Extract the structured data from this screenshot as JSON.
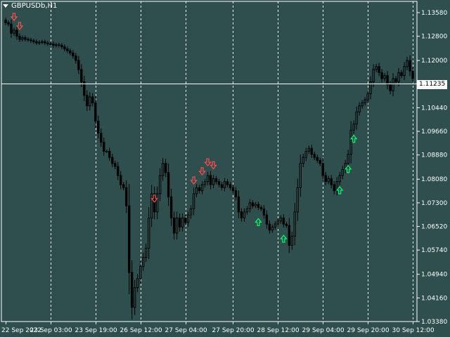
{
  "window": {
    "symbol_title": "GBPUSDb,H1"
  },
  "current_price": "1.11235",
  "colors": {
    "background": "#2f4f4f",
    "grid": "#ffffff",
    "bull_candle": "#000000",
    "bear_candle": "#000000",
    "wick": "#000000",
    "up_arrow": "#00ff66",
    "down_arrow": "#ff4d4d"
  },
  "chart_data": {
    "type": "candlestick",
    "symbol": "GBPUSDb",
    "timeframe": "H1",
    "y_axis_ticks": [
      "1.13580",
      "1.12800",
      "1.12000",
      "1.11235",
      "1.10440",
      "1.09660",
      "1.08880",
      "1.08080",
      "1.07300",
      "1.06520",
      "1.05740",
      "1.04940",
      "1.04160",
      "1.03380"
    ],
    "ylim": [
      1.0338,
      1.1395
    ],
    "x_axis_ticks": [
      "22 Sep 2022",
      "23 Sep 03:00",
      "23 Sep 19:00",
      "26 Sep 12:00",
      "27 Sep 04:00",
      "27 Sep 20:00",
      "28 Sep 12:00",
      "29 Sep 04:00",
      "29 Sep 20:00",
      "30 Sep 12:00"
    ],
    "close": [
      1.1325,
      1.132,
      1.129,
      1.13,
      1.128,
      1.127,
      1.1275,
      1.127,
      1.1268,
      1.1265,
      1.1262,
      1.1258,
      1.126,
      1.1262,
      1.1258,
      1.1255,
      1.1255,
      1.125,
      1.1252,
      1.125,
      1.1245,
      1.1238,
      1.1232,
      1.1225,
      1.1215,
      1.12,
      1.117,
      1.113,
      1.1085,
      1.105,
      1.108,
      1.106,
      1.1,
      1.096,
      1.093,
      1.09,
      1.09,
      1.088,
      1.086,
      1.085,
      1.082,
      1.079,
      1.078,
      1.072,
      1.05,
      1.0385,
      1.045,
      1.048,
      1.052,
      1.055,
      1.058,
      1.068,
      1.076,
      1.07,
      1.076,
      1.082,
      1.086,
      1.083,
      1.075,
      1.068,
      1.063,
      1.068,
      1.065,
      1.068,
      1.0665,
      1.069,
      1.071,
      1.076,
      1.078,
      1.077,
      1.079,
      1.08,
      1.082,
      1.079,
      1.081,
      1.08,
      1.079,
      1.078,
      1.08,
      1.079,
      1.078,
      1.077,
      1.075,
      1.07,
      1.068,
      1.07,
      1.071,
      1.073,
      1.072,
      1.0725,
      1.0715,
      1.071,
      1.069,
      1.066,
      1.064,
      1.065,
      1.066,
      1.067,
      1.068,
      1.066,
      1.0655,
      1.059,
      1.062,
      1.07,
      1.078,
      1.086,
      1.088,
      1.09,
      1.091,
      1.089,
      1.088,
      1.087,
      1.086,
      1.082,
      1.08,
      1.081,
      1.079,
      1.077,
      1.08,
      1.082,
      1.084,
      1.086,
      1.089,
      1.097,
      1.099,
      1.103,
      1.105,
      1.106,
      1.107,
      1.109,
      1.113,
      1.117,
      1.118,
      1.116,
      1.114,
      1.115,
      1.112,
      1.11,
      1.114,
      1.113,
      1.116,
      1.115,
      1.118,
      1.12,
      1.1165,
      1.114
    ],
    "up_arrows_at": [
      90,
      99,
      119,
      122,
      124
    ],
    "down_arrows_at": [
      3,
      5,
      67,
      70,
      72,
      74,
      53
    ]
  }
}
